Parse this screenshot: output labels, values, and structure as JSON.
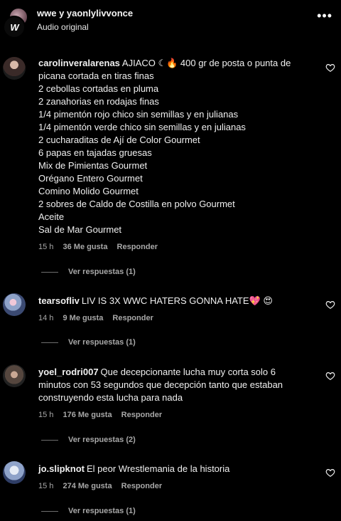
{
  "header": {
    "title": "wwe y yaonlylivvonce",
    "subtitle": "Audio original",
    "logo_text": "W"
  },
  "comments": [
    {
      "username": "carolinveralarenas",
      "lines": [
        "AJIACO ☾🔥 400 gr de posta o punta de",
        "picana cortada en tiras finas",
        "2 cebollas cortadas en pluma",
        "2 zanahorias en rodajas finas",
        "1/4 pimentón rojo chico sin semillas y en julianas",
        "1/4 pimentón verde chico sin semillas y en julianas",
        "2 cucharaditas de Ají de Color Gourmet",
        "6 papas en tajadas gruesas",
        "Mix de Pimientas Gourmet",
        "Orégano Entero Gourmet",
        "Comino Molido Gourmet",
        "2 sobres de Caldo de Costilla en polvo Gourmet",
        "Aceite",
        "Sal de Mar Gourmet"
      ],
      "time": "15 h",
      "likes": "36 Me gusta",
      "reply": "Responder",
      "view_replies": "Ver respuestas (1)"
    },
    {
      "username": "tearsofliv",
      "lines": [
        "LIV IS 3X WWC HATERS GONNA HATE💖 😍"
      ],
      "time": "14 h",
      "likes": "9 Me gusta",
      "reply": "Responder",
      "view_replies": "Ver respuestas (1)"
    },
    {
      "username": "yoel_rodri007",
      "lines": [
        "Que decepcionante lucha muy corta solo 6",
        "minutos con 53 segundos que decepción tanto que estaban",
        "construyendo esta lucha para nada"
      ],
      "time": "15 h",
      "likes": "176 Me gusta",
      "reply": "Responder",
      "view_replies": "Ver respuestas (2)"
    },
    {
      "username": "jo.slipknot",
      "lines": [
        "El peor Wrestlemania de la historia"
      ],
      "time": "15 h",
      "likes": "274 Me gusta",
      "reply": "Responder",
      "view_replies": "Ver respuestas (1)"
    }
  ],
  "colors": {
    "background": "#000000",
    "text": "#f5f5f5",
    "muted": "#a8a8a8"
  }
}
